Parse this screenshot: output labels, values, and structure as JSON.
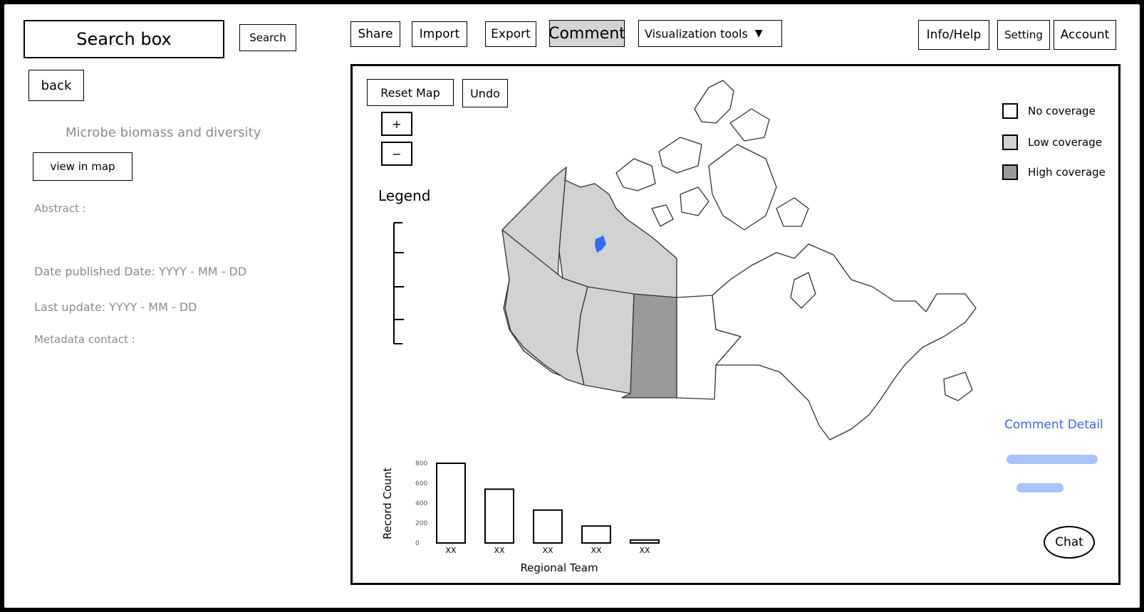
{
  "toolbar": {
    "search_box": "Search box",
    "search_button": "Search",
    "share": "Share",
    "import": "Import",
    "export": "Export",
    "comment": "Comment",
    "visualization_tools": "Visualization tools",
    "info_help": "Info/Help",
    "setting": "Setting",
    "account": "Account"
  },
  "sidebar": {
    "back": "back",
    "dataset_title": "Microbe biomass and diversity",
    "view_in_map": "view in map",
    "abstract_label": "Abstract :",
    "date_published": "Date published Date: YYYY - MM - DD",
    "last_update": "Last update: YYYY - MM - DD",
    "metadata_contact": "Metadata contact :"
  },
  "map": {
    "reset_map": "Reset Map",
    "undo": "Undo",
    "zoom_in": "+",
    "zoom_out": "−",
    "legend_title": "Legend",
    "coverage_legend": [
      {
        "label": "No coverage",
        "color": "#ffffff"
      },
      {
        "label": "Low coverage",
        "color": "#d2d2d2"
      },
      {
        "label": "High coverage",
        "color": "#9a9a9a"
      }
    ],
    "region_colors": {
      "low": "#d2d2d2",
      "high": "#9a9a9a",
      "marker": "#2f6df6"
    },
    "comment_detail": "Comment Detail",
    "chat": "Chat"
  },
  "chart_data": {
    "type": "bar",
    "categories": [
      "XX",
      "XX",
      "XX",
      "XX",
      "XX"
    ],
    "values": [
      800,
      540,
      330,
      170,
      30
    ],
    "ylim": [
      0,
      800
    ],
    "yticks": [
      0,
      200,
      400,
      600,
      800
    ],
    "xlabel": "Regional Team",
    "ylabel": "Record Count"
  }
}
